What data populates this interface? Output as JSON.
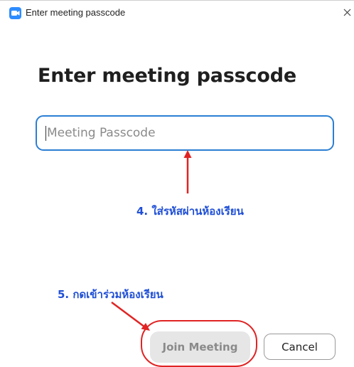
{
  "window": {
    "title": "Enter meeting passcode",
    "close_glyph": "×"
  },
  "dialog": {
    "heading": "Enter meeting passcode",
    "passcode_input": {
      "value": "",
      "placeholder": "Meeting Passcode"
    },
    "join_button_label": "Join Meeting",
    "cancel_button_label": "Cancel"
  },
  "annotations": {
    "step4": "4. ใส่รหัสผ่านห้องเรียน",
    "step5": "5. กดเข้าร่วมห้องเรียน"
  },
  "icons": {
    "app": "zoom-camera-icon",
    "close": "close-icon"
  },
  "colors": {
    "brand_blue": "#2d8cff",
    "input_border": "#2b7fd4",
    "annotation_text": "#1f4fd6",
    "annotation_red": "#e02424",
    "join_button_bg": "#e6e6e6",
    "join_button_text": "#8a8a8a"
  }
}
